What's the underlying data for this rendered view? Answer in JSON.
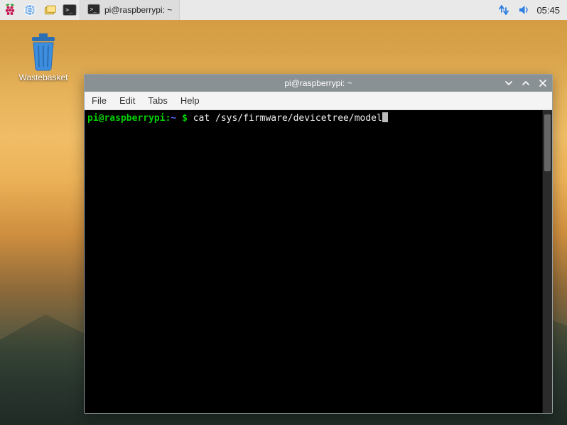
{
  "panel": {
    "task_button_label": "pi@raspberrypi: ~",
    "clock": "05:45",
    "tray": {
      "network": "network-icon",
      "sound": "volume-icon"
    }
  },
  "desktop": {
    "wastebasket_label": "Wastebasket"
  },
  "window": {
    "title": "pi@raspberrypi: ~",
    "menu": {
      "file": "File",
      "edit": "Edit",
      "tabs": "Tabs",
      "help": "Help"
    },
    "terminal": {
      "user_host": "pi@raspberrypi",
      "path": "~",
      "dollar": "$",
      "command": "cat /sys/firmware/devicetree/model"
    }
  }
}
